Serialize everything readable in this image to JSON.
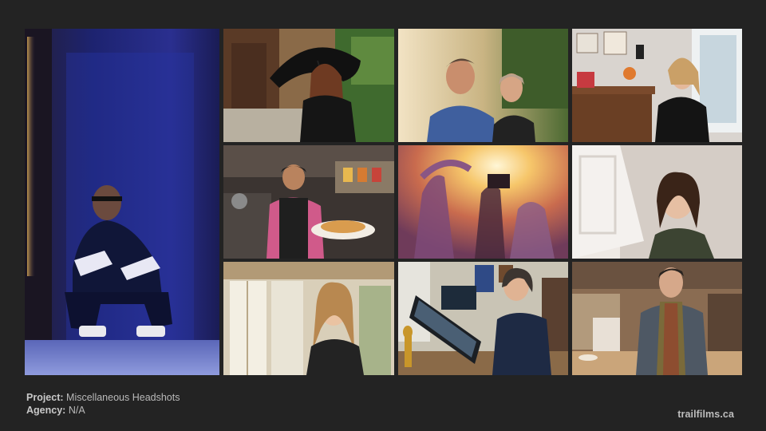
{
  "caption": {
    "project_label": "Project:",
    "project_value": "Miscellaneous Headshots",
    "agency_label": "Agency:",
    "agency_value": "N/A"
  },
  "site": {
    "name": "trailfilms.ca"
  },
  "colors": {
    "background": "#232323",
    "caption_text": "#b9b9b9"
  }
}
